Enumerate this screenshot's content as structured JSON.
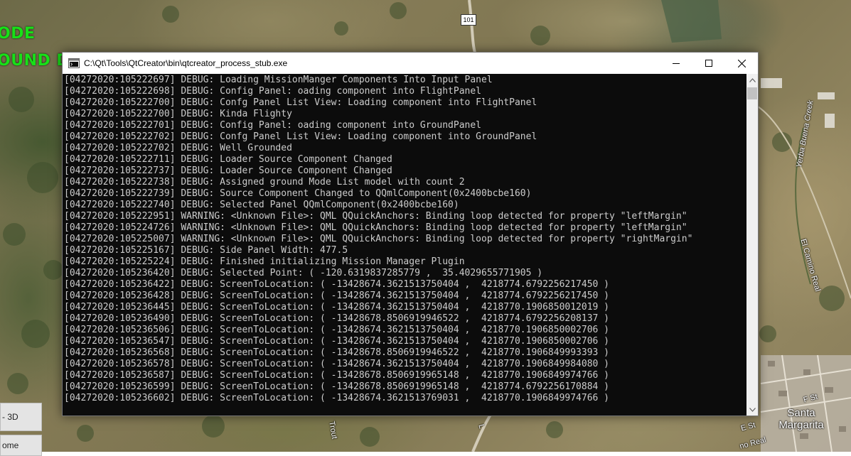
{
  "background": {
    "road_labels": {
      "highway": "101",
      "el_camino_real": "El Camino Real",
      "creek": "Yerba Buena Creek",
      "f_st": "F St",
      "e_st": "E St",
      "camino_real_partial": "no Real",
      "trout_partial": "Trout",
      "l_partial": "L"
    },
    "town": "Santa Margarita"
  },
  "overlay": {
    "mode_line_1": "ODE",
    "mode_line_2": "OUND D",
    "text_color": "#18e018"
  },
  "side_buttons": {
    "view_3d": "- 3D",
    "home": "ome"
  },
  "window": {
    "title": "C:\\Qt\\Tools\\QtCreator\\bin\\qtcreator_process_stub.exe",
    "icons": {
      "app": "console-app-icon",
      "minimize": "minimize-icon",
      "maximize": "maximize-icon",
      "close": "close-icon"
    },
    "console_lines": [
      "[04272020:105222697] DEBUG: Loading MissionManger Components Into Input Panel",
      "[04272020:105222698] DEBUG: Config Panel: oading component into FlightPanel",
      "[04272020:105222700] DEBUG: Confg Panel List View: Loading component into FlightPanel",
      "[04272020:105222700] DEBUG: Kinda Flighty",
      "[04272020:105222701] DEBUG: Config Panel: oading component into GroundPanel",
      "[04272020:105222702] DEBUG: Confg Panel List View: Loading component into GroundPanel",
      "[04272020:105222702] DEBUG: Well Grounded",
      "[04272020:105222711] DEBUG: Loader Source Component Changed",
      "[04272020:105222737] DEBUG: Loader Source Component Changed",
      "[04272020:105222738] DEBUG: Assigned ground Mode List model with count 2",
      "[04272020:105222739] DEBUG: Source Component Changed to QQmlComponent(0x2400bcbe160)",
      "[04272020:105222740] DEBUG: Selected Panel QQmlComponent(0x2400bcbe160)",
      "[04272020:105222951] WARNING: <Unknown File>: QML QQuickAnchors: Binding loop detected for property \"leftMargin\"",
      "[04272020:105224726] WARNING: <Unknown File>: QML QQuickAnchors: Binding loop detected for property \"leftMargin\"",
      "[04272020:105225007] WARNING: <Unknown File>: QML QQuickAnchors: Binding loop detected for property \"rightMargin\"",
      "[04272020:105225167] DEBUG: Side Panel Width: 477.5",
      "[04272020:105225224] DEBUG: Finished initializing Mission Manager Plugin",
      "[04272020:105236420] DEBUG: Selected Point: ( -120.6319837285779 ,  35.4029655771905 )",
      "[04272020:105236422] DEBUG: ScreenToLocation: ( -13428674.3621513750404 ,  4218774.6792256217450 )",
      "[04272020:105236428] DEBUG: ScreenToLocation: ( -13428674.3621513750404 ,  4218774.6792256217450 )",
      "[04272020:105236445] DEBUG: ScreenToLocation: ( -13428674.3621513750404 ,  4218770.1906850012019 )",
      "[04272020:105236490] DEBUG: ScreenToLocation: ( -13428678.8506919946522 ,  4218774.6792256208137 )",
      "[04272020:105236506] DEBUG: ScreenToLocation: ( -13428674.3621513750404 ,  4218770.1906850002706 )",
      "[04272020:105236547] DEBUG: ScreenToLocation: ( -13428674.3621513750404 ,  4218770.1906850002706 )",
      "[04272020:105236568] DEBUG: ScreenToLocation: ( -13428678.8506919946522 ,  4218770.1906849993393 )",
      "[04272020:105236578] DEBUG: ScreenToLocation: ( -13428674.3621513750404 ,  4218770.1906849984080 )",
      "[04272020:105236587] DEBUG: ScreenToLocation: ( -13428678.8506919965148 ,  4218770.1906849974766 )",
      "[04272020:105236599] DEBUG: ScreenToLocation: ( -13428678.8506919965148 ,  4218774.6792256170884 )",
      "[04272020:105236602] DEBUG: ScreenToLocation: ( -13428674.3621513769031 ,  4218770.1906849974766 )"
    ]
  }
}
